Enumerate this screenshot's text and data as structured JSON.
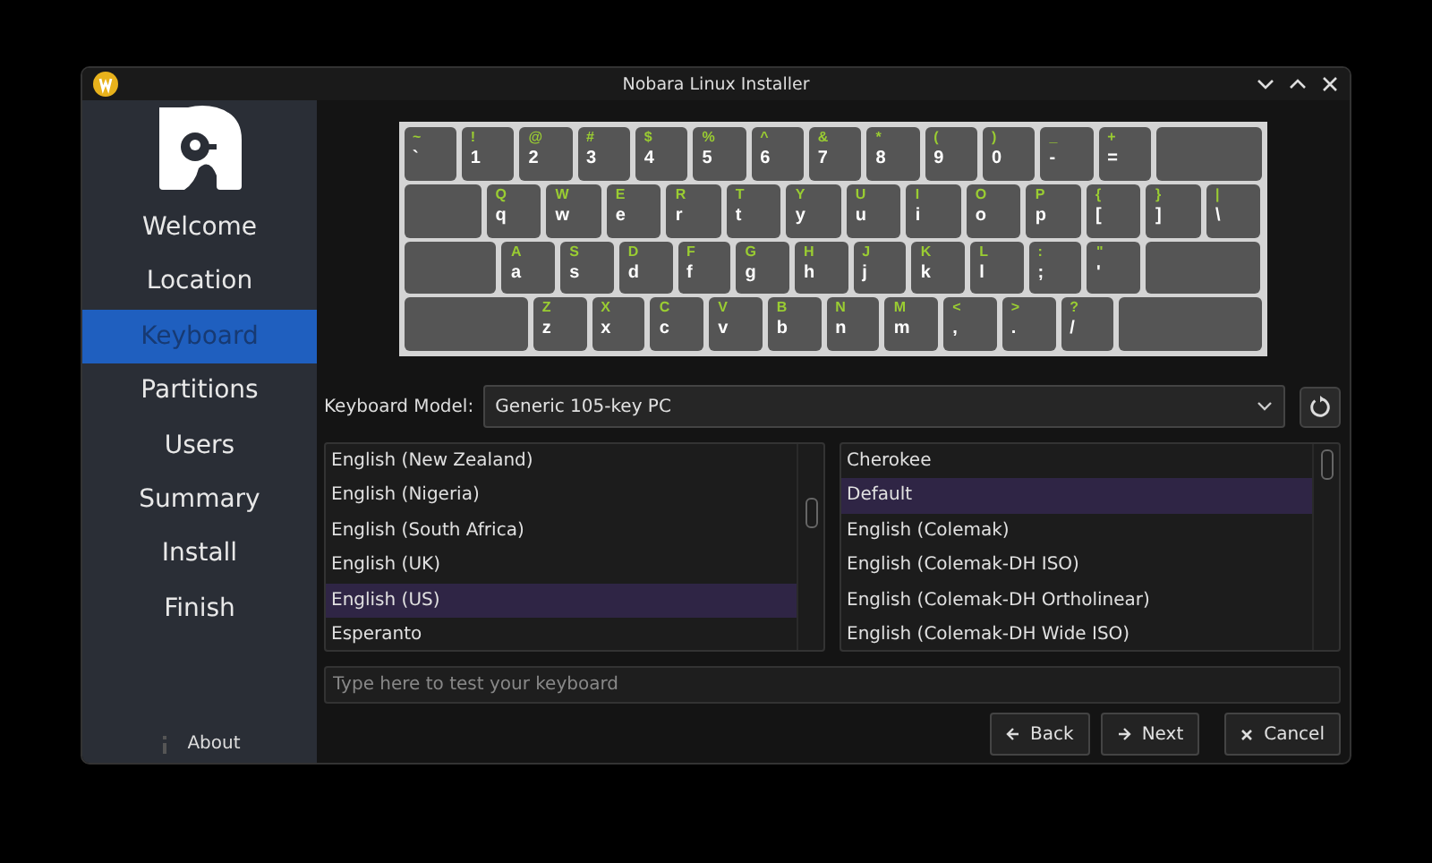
{
  "window": {
    "title": "Nobara Linux Installer"
  },
  "sidebar": {
    "items": [
      {
        "label": "Welcome",
        "selected": false
      },
      {
        "label": "Location",
        "selected": false
      },
      {
        "label": "Keyboard",
        "selected": true
      },
      {
        "label": "Partitions",
        "selected": false
      },
      {
        "label": "Users",
        "selected": false
      },
      {
        "label": "Summary",
        "selected": false
      },
      {
        "label": "Install",
        "selected": false
      },
      {
        "label": "Finish",
        "selected": false
      }
    ],
    "about": "About"
  },
  "keyboard": {
    "rows": [
      [
        {
          "kind": "char",
          "upper": "~",
          "lower": "`"
        },
        {
          "kind": "char",
          "upper": "!",
          "lower": "1"
        },
        {
          "kind": "char",
          "upper": "@",
          "lower": "2"
        },
        {
          "kind": "char",
          "upper": "#",
          "lower": "3"
        },
        {
          "kind": "char",
          "upper": "$",
          "lower": "4"
        },
        {
          "kind": "char",
          "upper": "%",
          "lower": "5"
        },
        {
          "kind": "char",
          "upper": "^",
          "lower": "6"
        },
        {
          "kind": "char",
          "upper": "&",
          "lower": "7"
        },
        {
          "kind": "char",
          "upper": "*",
          "lower": "8"
        },
        {
          "kind": "char",
          "upper": "(",
          "lower": "9"
        },
        {
          "kind": "char",
          "upper": ")",
          "lower": "0"
        },
        {
          "kind": "char",
          "upper": "_",
          "lower": "-"
        },
        {
          "kind": "char",
          "upper": "+",
          "lower": "="
        },
        {
          "kind": "backspace"
        }
      ],
      [
        {
          "kind": "tab"
        },
        {
          "kind": "char",
          "upper": "Q",
          "lower": "q"
        },
        {
          "kind": "char",
          "upper": "W",
          "lower": "w"
        },
        {
          "kind": "char",
          "upper": "E",
          "lower": "e"
        },
        {
          "kind": "char",
          "upper": "R",
          "lower": "r"
        },
        {
          "kind": "char",
          "upper": "T",
          "lower": "t"
        },
        {
          "kind": "char",
          "upper": "Y",
          "lower": "y"
        },
        {
          "kind": "char",
          "upper": "U",
          "lower": "u"
        },
        {
          "kind": "char",
          "upper": "I",
          "lower": "i"
        },
        {
          "kind": "char",
          "upper": "O",
          "lower": "o"
        },
        {
          "kind": "char",
          "upper": "P",
          "lower": "p"
        },
        {
          "kind": "char",
          "upper": "{",
          "lower": "["
        },
        {
          "kind": "char",
          "upper": "}",
          "lower": "]"
        },
        {
          "kind": "char",
          "upper": "|",
          "lower": "\\"
        }
      ],
      [
        {
          "kind": "caps"
        },
        {
          "kind": "char",
          "upper": "A",
          "lower": "a"
        },
        {
          "kind": "char",
          "upper": "S",
          "lower": "s"
        },
        {
          "kind": "char",
          "upper": "D",
          "lower": "d"
        },
        {
          "kind": "char",
          "upper": "F",
          "lower": "f"
        },
        {
          "kind": "char",
          "upper": "G",
          "lower": "g"
        },
        {
          "kind": "char",
          "upper": "H",
          "lower": "h"
        },
        {
          "kind": "char",
          "upper": "J",
          "lower": "j"
        },
        {
          "kind": "char",
          "upper": "K",
          "lower": "k"
        },
        {
          "kind": "char",
          "upper": "L",
          "lower": "l"
        },
        {
          "kind": "char",
          "upper": ":",
          "lower": ";"
        },
        {
          "kind": "char",
          "upper": "\"",
          "lower": "'"
        },
        {
          "kind": "enter"
        }
      ],
      [
        {
          "kind": "shift"
        },
        {
          "kind": "char",
          "upper": "Z",
          "lower": "z"
        },
        {
          "kind": "char",
          "upper": "X",
          "lower": "x"
        },
        {
          "kind": "char",
          "upper": "C",
          "lower": "c"
        },
        {
          "kind": "char",
          "upper": "V",
          "lower": "v"
        },
        {
          "kind": "char",
          "upper": "B",
          "lower": "b"
        },
        {
          "kind": "char",
          "upper": "N",
          "lower": "n"
        },
        {
          "kind": "char",
          "upper": "M",
          "lower": "m"
        },
        {
          "kind": "char",
          "upper": "<",
          "lower": ","
        },
        {
          "kind": "char",
          "upper": ">",
          "lower": "."
        },
        {
          "kind": "char",
          "upper": "?",
          "lower": "/"
        },
        {
          "kind": "rshift"
        }
      ]
    ]
  },
  "model": {
    "label": "Keyboard Model:",
    "value": "Generic 105-key PC"
  },
  "layouts": [
    {
      "label": "English (New Zealand)",
      "selected": false
    },
    {
      "label": "English (Nigeria)",
      "selected": false
    },
    {
      "label": "English (South Africa)",
      "selected": false
    },
    {
      "label": "English (UK)",
      "selected": false
    },
    {
      "label": "English (US)",
      "selected": true
    },
    {
      "label": "Esperanto",
      "selected": false
    }
  ],
  "variants": [
    {
      "label": "Cherokee",
      "selected": false
    },
    {
      "label": "Default",
      "selected": true
    },
    {
      "label": "English (Colemak)",
      "selected": false
    },
    {
      "label": "English (Colemak-DH ISO)",
      "selected": false
    },
    {
      "label": "English (Colemak-DH Ortholinear)",
      "selected": false
    },
    {
      "label": "English (Colemak-DH Wide ISO)",
      "selected": false
    }
  ],
  "test": {
    "placeholder": "Type here to test your keyboard"
  },
  "buttons": [
    {
      "kind": "back",
      "label": "Back"
    },
    {
      "kind": "next",
      "label": "Next"
    },
    {
      "kind": "cancel",
      "label": "Cancel"
    }
  ]
}
